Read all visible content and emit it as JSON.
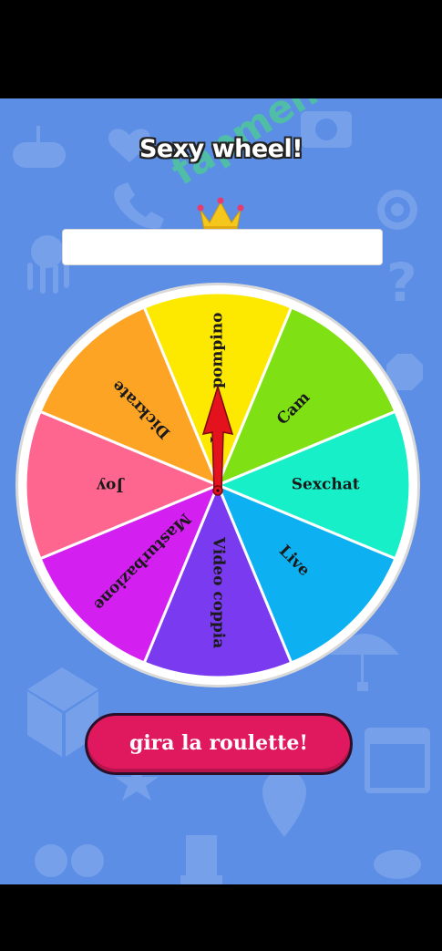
{
  "app": {
    "title": "Sexy wheel!",
    "name_input": {
      "value": "",
      "placeholder": ""
    },
    "spin_button_label": "gira la roulette!",
    "watermark": "fapmenu.com"
  },
  "wheel": {
    "segments": [
      {
        "label": "Video pompino",
        "color": "#fde800"
      },
      {
        "label": "Cam",
        "color": "#7fe114"
      },
      {
        "label": "Sexchat",
        "color": "#17efc9"
      },
      {
        "label": "Live",
        "color": "#0db1f2"
      },
      {
        "label": "Video coppia",
        "color": "#7a3bf0"
      },
      {
        "label": "Masturbazione",
        "color": "#d31ff0"
      },
      {
        "label": "Joy",
        "color": "#fe6690"
      },
      {
        "label": "Dickrate",
        "color": "#fea425"
      }
    ],
    "pointer_color": "#e3121d",
    "rim_color": "#ffffff"
  },
  "colors": {
    "background": "#5c8ee6",
    "button": "#e0195f",
    "crown": "#f5c61b",
    "watermark": "#4ec79a"
  }
}
